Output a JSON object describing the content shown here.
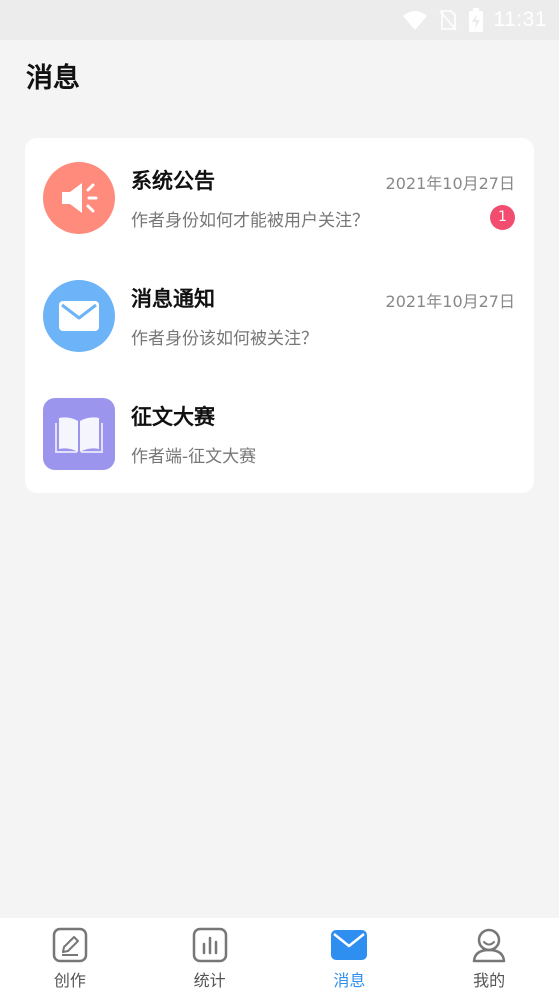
{
  "status_bar": {
    "time": "11:31"
  },
  "page": {
    "title": "消息"
  },
  "messages": [
    {
      "title": "系统公告",
      "preview": "作者身份如何才能被用户关注？",
      "date": "2021年10月27日",
      "badge": "1",
      "icon": "megaphone-icon",
      "icon_bg": "#fe8b7c"
    },
    {
      "title": "消息通知",
      "preview": "作者身份该如何被关注？",
      "date": "2021年10月27日",
      "icon": "envelope-icon",
      "icon_bg": "#6cb3f7"
    },
    {
      "title": "征文大赛",
      "preview": "作者端-征文大赛",
      "icon": "book-icon",
      "icon_bg": "#9b95ee"
    }
  ],
  "tabs": [
    {
      "label": "创作",
      "icon": "edit-icon"
    },
    {
      "label": "统计",
      "icon": "chart-icon"
    },
    {
      "label": "消息",
      "icon": "message-icon",
      "active": true
    },
    {
      "label": "我的",
      "icon": "user-icon"
    }
  ],
  "colors": {
    "accent": "#2f8ff0",
    "badge": "#f24c6e",
    "tab_inactive": "#555555"
  }
}
